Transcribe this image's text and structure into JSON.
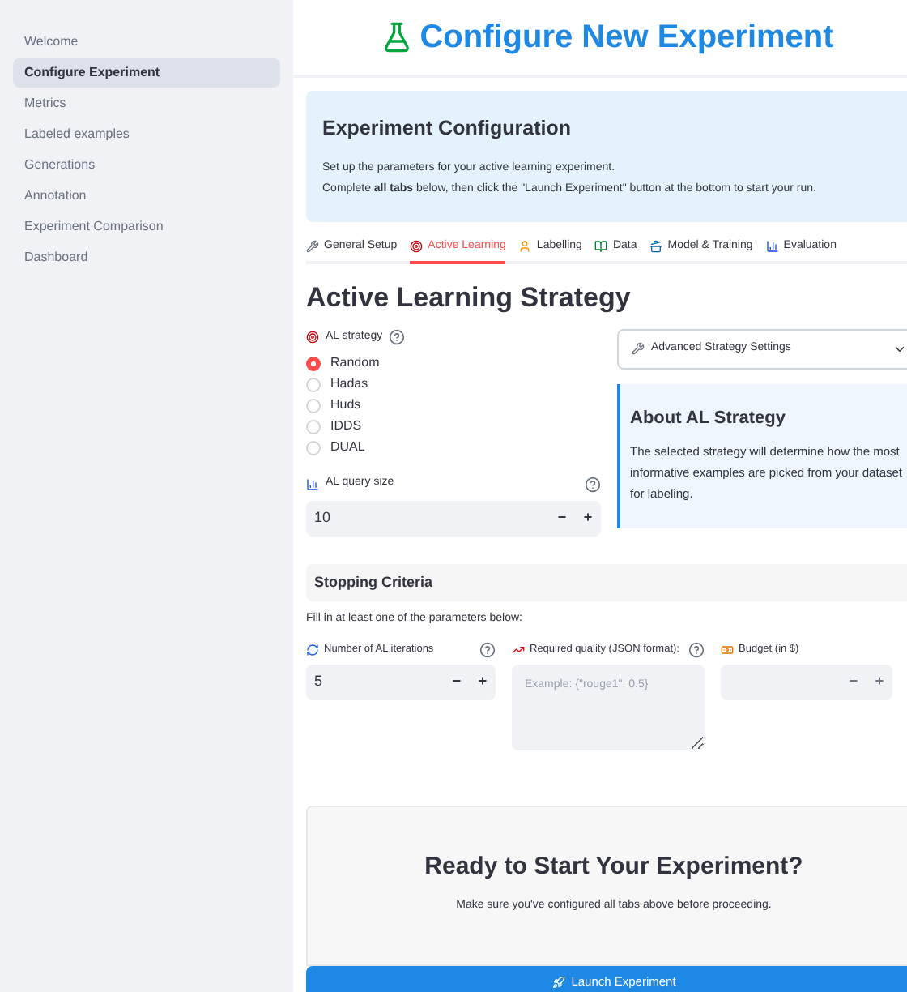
{
  "sidebar": {
    "items": [
      {
        "label": "Welcome",
        "selected": false
      },
      {
        "label": "Configure Experiment",
        "selected": true
      },
      {
        "label": "Metrics",
        "selected": false
      },
      {
        "label": "Labeled examples",
        "selected": false
      },
      {
        "label": "Generations",
        "selected": false
      },
      {
        "label": "Annotation",
        "selected": false
      },
      {
        "label": "Experiment Comparison",
        "selected": false
      },
      {
        "label": "Dashboard",
        "selected": false
      }
    ]
  },
  "page_title": "Configure New Experiment",
  "info_box": {
    "title": "Experiment Configuration",
    "lines": [
      "Set up the parameters for your active learning experiment.",
      "Complete **all tabs** below, then click the \"Launch Experiment\" button at the bottom to start your run."
    ]
  },
  "tabs": [
    {
      "label": "General Setup",
      "kind": "wrench",
      "selected": false
    },
    {
      "label": "Active Learning",
      "kind": "target",
      "selected": true
    },
    {
      "label": "Labelling",
      "kind": "person",
      "selected": false
    },
    {
      "label": "Data",
      "kind": "books",
      "selected": false
    },
    {
      "label": "Model & Training",
      "kind": "pot",
      "selected": false
    },
    {
      "label": "Evaluation",
      "kind": "chart",
      "selected": false
    }
  ],
  "section_title": "Active Learning Strategy",
  "strategy": {
    "label": "AL strategy",
    "options": [
      {
        "label": "Random",
        "selected": true
      },
      {
        "label": "Hadas",
        "selected": false
      },
      {
        "label": "Huds",
        "selected": false
      },
      {
        "label": "IDDS",
        "selected": false
      },
      {
        "label": "DUAL",
        "selected": false
      }
    ]
  },
  "query_size": {
    "label": "AL query size",
    "value": "10",
    "minus": "−",
    "plus": "+"
  },
  "expander": {
    "label": "Advanced Strategy Settings",
    "expanded": false
  },
  "about": {
    "title": "About AL Strategy",
    "text": "The selected strategy will determine how the most informative examples are picked from your dataset for labeling."
  },
  "stopping": {
    "title": "Stopping Criteria",
    "hint": "Fill in at least one of the parameters below:",
    "iterations": {
      "label": "Number of AL iterations",
      "value": "5",
      "minus": "−",
      "plus": "+",
      "disabled": false
    },
    "quality": {
      "label": "Required quality (JSON format):",
      "placeholder": "Example: {\"rouge1\": 0.5}"
    },
    "budget": {
      "label": "Budget (in $)",
      "minus": "−",
      "plus": "+",
      "disabled": true
    }
  },
  "ready": {
    "title": "Ready to Start Your Experiment?",
    "text": "Make sure you've configured all tabs above before proceeding."
  },
  "launch_button": "Launch Experiment"
}
